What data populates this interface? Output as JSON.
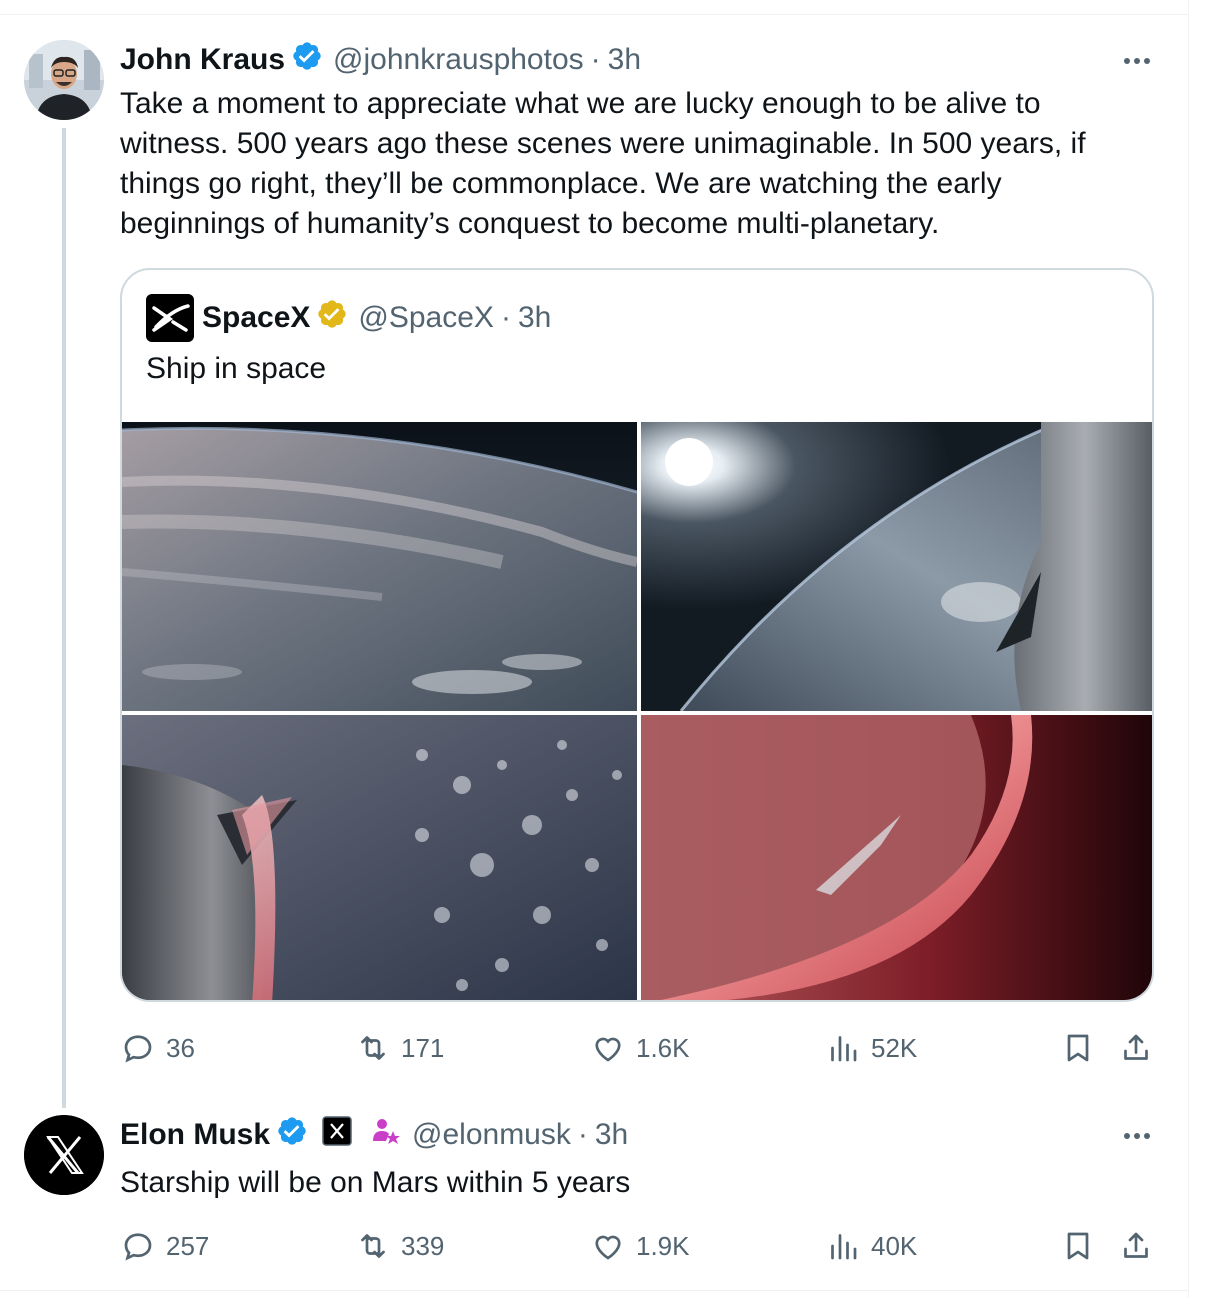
{
  "tweet1": {
    "author_name": "John Kraus",
    "handle": "@johnkrausphotos",
    "separator": "·",
    "time": "3h",
    "text_lines": [
      "Take a moment to appreciate what we are lucky enough to be alive to",
      "witness. 500 years ago these scenes were unimaginable. In 500 years, if",
      "things go right, they’ll be commonplace. We are watching the early",
      "beginnings of humanity’s conquest to become multi-planetary."
    ],
    "quote": {
      "author_name": "SpaceX",
      "handle": "@SpaceX",
      "separator": "·",
      "time": "3h",
      "text": "Ship in space"
    },
    "stats": {
      "replies": "36",
      "reposts": "171",
      "likes": "1.6K",
      "views": "52K"
    }
  },
  "tweet2": {
    "author_name": "Elon Musk",
    "handle": "@elonmusk",
    "separator": "·",
    "time": "3h",
    "text": "Starship will be on Mars within 5 years",
    "stats": {
      "replies": "257",
      "reposts": "339",
      "likes": "1.9K",
      "views": "40K"
    }
  },
  "colors": {
    "verified_blue": "#1d9bf0",
    "gold_badge": "#e2b719",
    "muted_text": "#536471",
    "border": "#cfd9de"
  },
  "icons": [
    "verified-badge-icon",
    "gold-verified-badge-icon",
    "more-icon",
    "reply-icon",
    "repost-icon",
    "like-icon",
    "views-icon",
    "bookmark-icon",
    "share-icon",
    "x-logo-icon",
    "spacex-logo-icon",
    "subscriber-badge-icon"
  ]
}
